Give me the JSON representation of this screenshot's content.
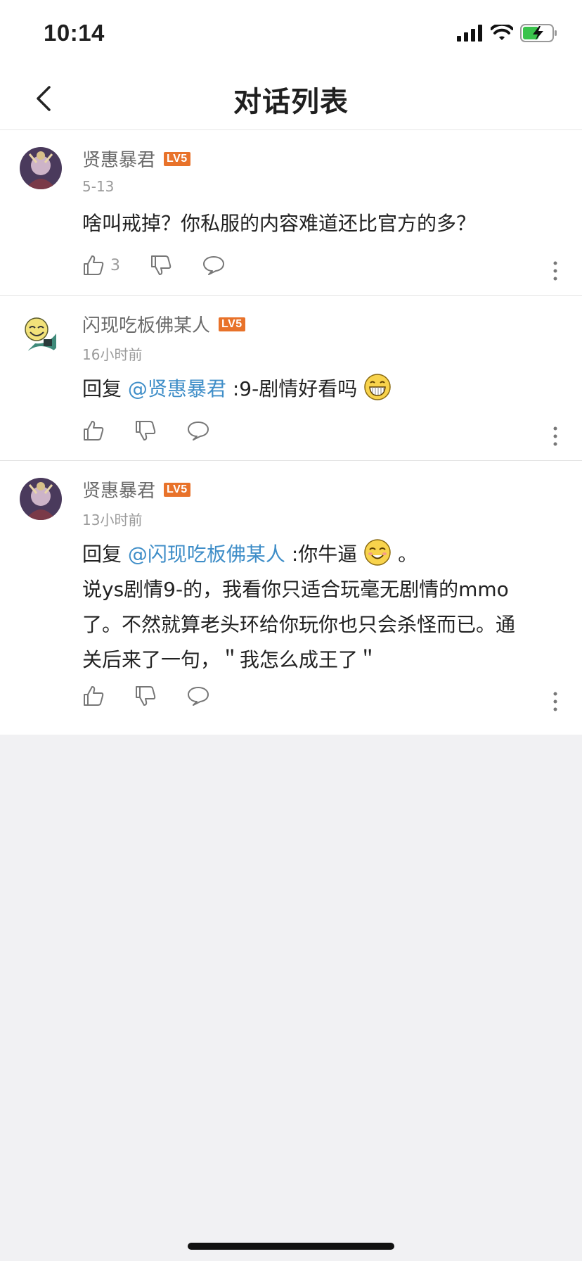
{
  "status_bar": {
    "time": "10:14"
  },
  "header": {
    "title": "对话列表"
  },
  "comments": [
    {
      "author": "贤惠暴君",
      "level": "LV5",
      "date": "5-13",
      "text": "啥叫戒掉？你私服的内容难道还比官方的多？",
      "like_count": "3"
    },
    {
      "author": "闪现吃板佛某人",
      "level": "LV5",
      "date": "16小时前",
      "reply_prefix": "回复",
      "mention": "@贤惠暴君",
      "text": ":9-剧情好看吗",
      "emoji": "grinning-emoji"
    },
    {
      "author": "贤惠暴君",
      "level": "LV5",
      "date": "13小时前",
      "reply_prefix": "回复",
      "mention": "@闪现吃板佛某人",
      "text_before_emoji": ":你牛逼",
      "emoji": "smiling-emoji",
      "text_after_emoji": "。",
      "line2": "说ys剧情9-的，我看你只适合玩毫无剧情的mmo",
      "line3": "了。不然就算老头环给你玩你也只会杀怪而已。通",
      "line4": "关后来了一句，＂我怎么成王了＂"
    }
  ],
  "colors": {
    "mention": "#3f8ec8",
    "badge": "#e8722a",
    "background": "#f1f1f3"
  }
}
